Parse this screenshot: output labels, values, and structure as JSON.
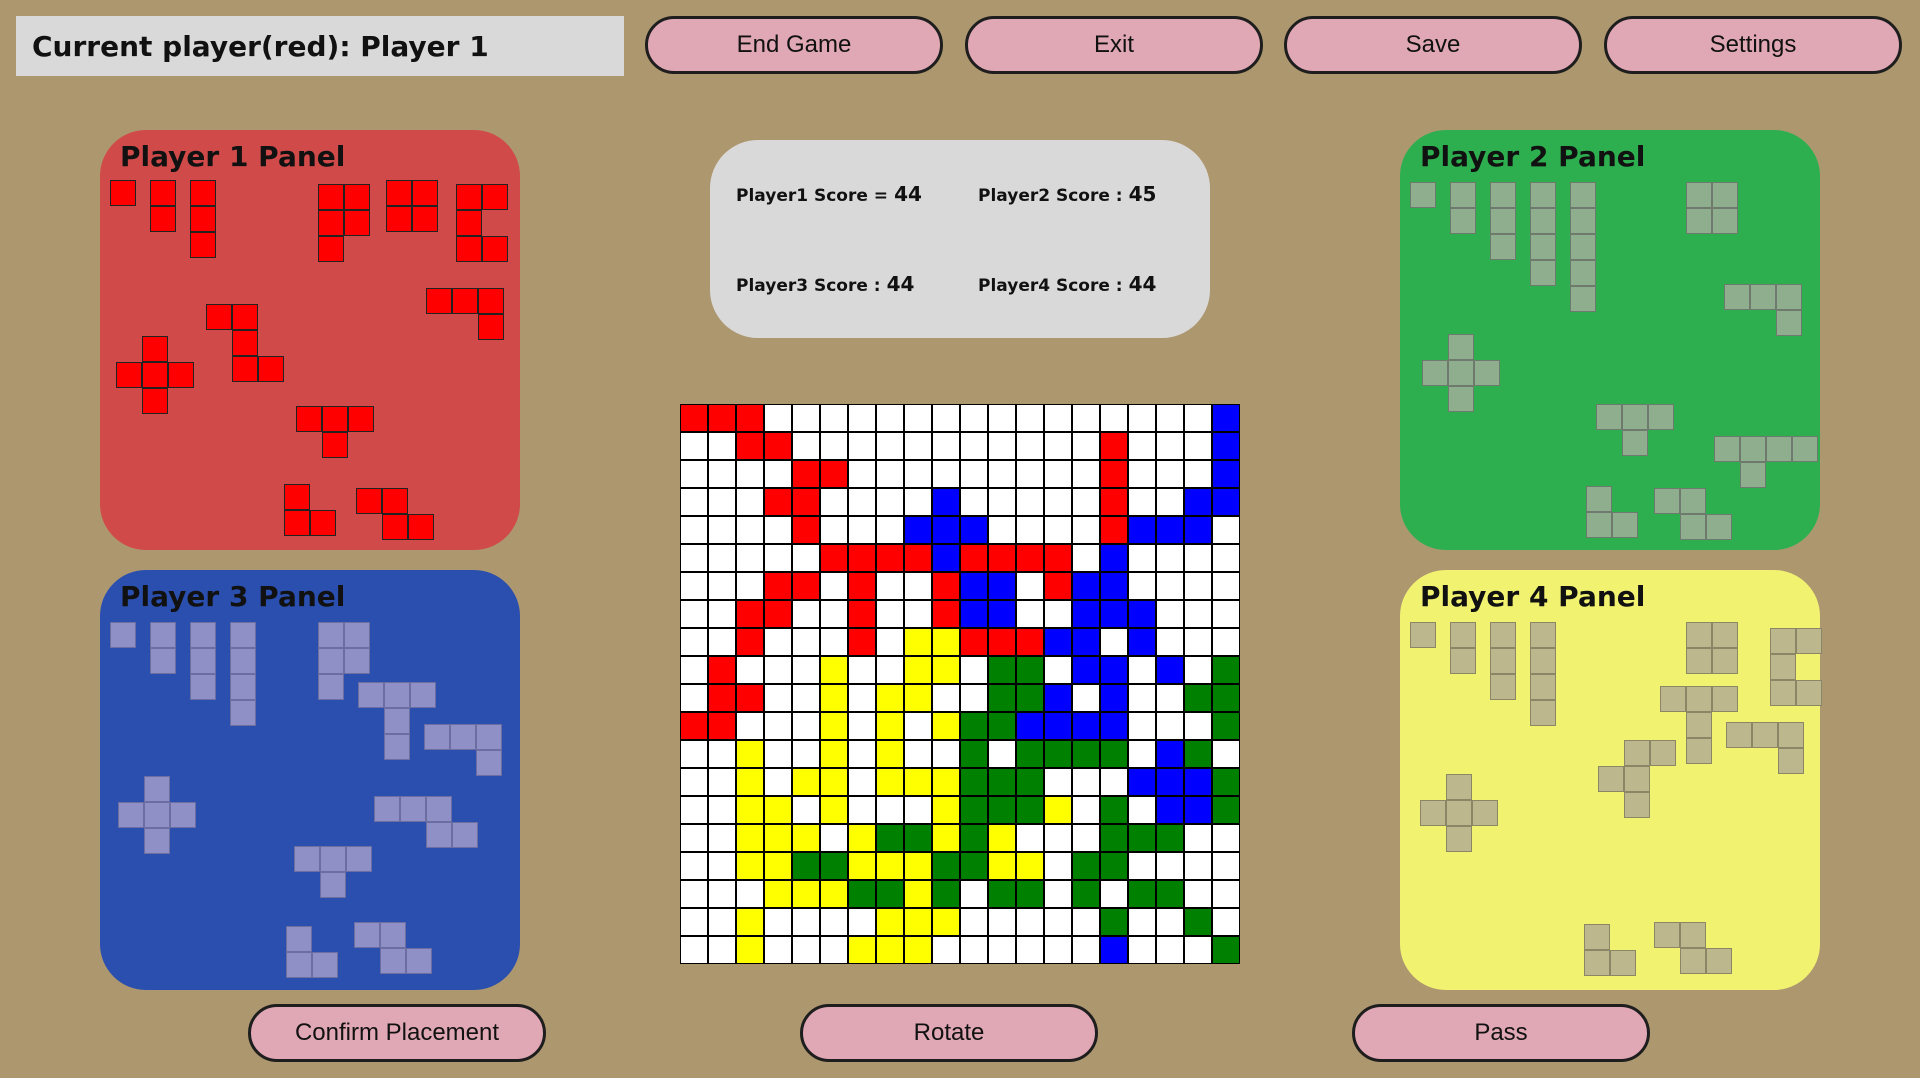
{
  "status": {
    "text": "Current player(red): Player 1"
  },
  "top_buttons": [
    {
      "label": "End Game",
      "name": "end-game-button"
    },
    {
      "label": "Exit",
      "name": "exit-button"
    },
    {
      "label": "Save",
      "name": "save-button"
    },
    {
      "label": "Settings",
      "name": "settings-button"
    }
  ],
  "bottom_buttons": [
    {
      "label": "Confirm Placement",
      "name": "confirm-placement-button"
    },
    {
      "label": "Rotate",
      "name": "rotate-button"
    },
    {
      "label": "Pass",
      "name": "pass-button"
    }
  ],
  "panels": [
    {
      "title": "Player 1 Panel",
      "color": "#d04a4a",
      "tile": "#ff0000",
      "tile_border": "#222222",
      "active": true
    },
    {
      "title": "Player 2 Panel",
      "color": "#2daf4f",
      "tile": "#8fae8d",
      "tile_border": "#6e7a6e",
      "active": false
    },
    {
      "title": "Player 3 Panel",
      "color": "#2a4fae",
      "tile": "#8e90c6",
      "tile_border": "#6c6ea2",
      "active": false
    },
    {
      "title": "Player 4 Panel",
      "color": "#f2f271",
      "tile": "#bcb78d",
      "tile_border": "#8a8666",
      "active": false
    }
  ],
  "scores": [
    {
      "label": "Player1 Score =",
      "value": "44"
    },
    {
      "label": "Player2 Score :",
      "value": "45"
    },
    {
      "label": "Player3 Score :",
      "value": "44"
    },
    {
      "label": "Player4 Score :",
      "value": "44"
    }
  ],
  "board": {
    "size": 20,
    "colors": {
      "R": "#ff0000",
      "B": "#0000ff",
      "G": "#008000",
      "Y": "#ffff00",
      ".": "#ffffff"
    },
    "rows": [
      "RRR................B",
      "..RR...........R...B",
      "....RR.........R...B",
      "...RR....B.....R..BB",
      "....R...BBB....RBBB.",
      ".....RRRRBRRRR.B....",
      "...RR.R..RBB.RBB....",
      "..RR..R..RBB..BBB...",
      "..R...R.YYRRRBB.B...",
      ".R...Y..YY.GG.BB.B.G",
      ".RR..Y.YY..GGB.B..GG",
      "RR...Y.Y.YGGBBBB...G",
      "..Y..Y.Y..G.GGGG.BG.",
      "..Y.YY.YYYGGG...BBBG",
      "..YY.Y...YGGGY.G.BBG",
      "..YYY.YGGYGY...GGG..",
      "..YYGGYYYGGYY.GG....",
      "...YYYGGYG.GG.G.GG..",
      "..Y....YYY.....G..G.",
      "..Y...YYY......B...G",
      "..Y............B...G",
      "YYY................G"
    ]
  }
}
